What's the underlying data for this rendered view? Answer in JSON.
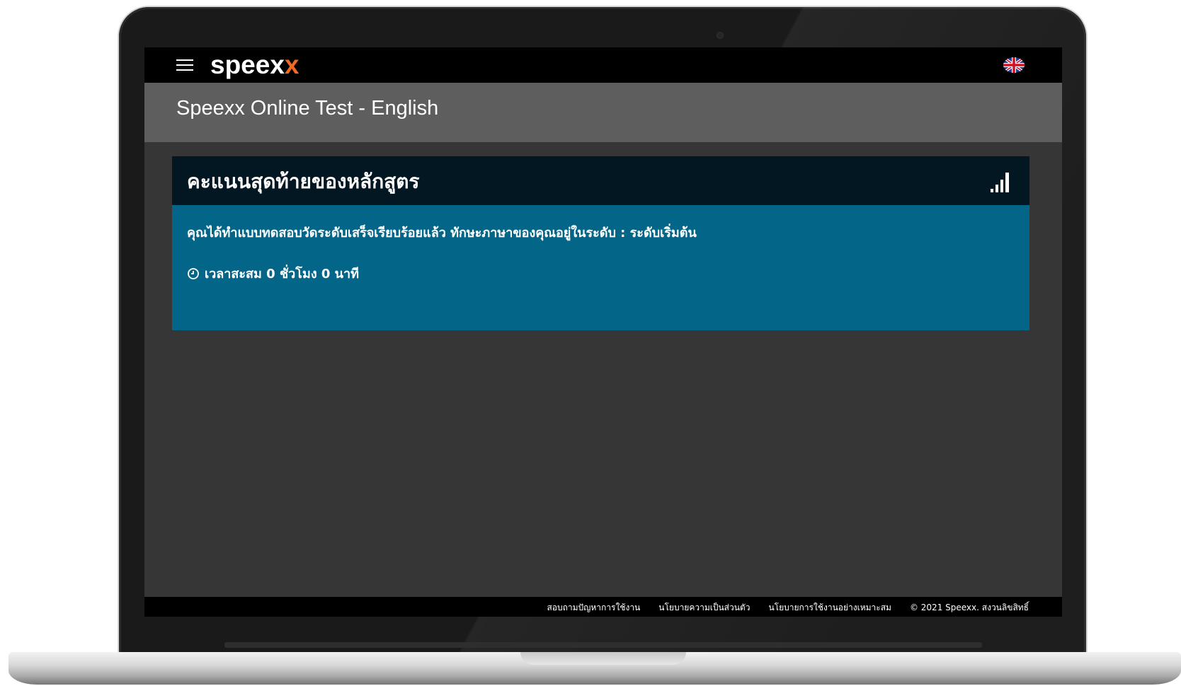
{
  "app": {
    "logo_prefix": "speex",
    "logo_suffix": "x",
    "brand_accent": "#f26a21"
  },
  "header": {
    "title": "Speexx Online Test - English",
    "menu_icon": "hamburger-menu-icon",
    "language_icon": "uk-flag-icon"
  },
  "result_card": {
    "title": "คะแนนสุดท้ายของหลักสูตร",
    "title_icon": "signal-bars-icon",
    "message": "คุณได้ทำแบบทดสอบวัดระดับเสร็จเรียบร้อยแล้ว ทักษะภาษาของคุณอยู่ในระดับ : ระดับเริ่มต้น",
    "time_icon": "clock-icon",
    "time_text": "เวลาสะสม 0 ชั่วโมง 0 นาที",
    "header_color": "#031722",
    "body_color": "#036688"
  },
  "footer": {
    "links": [
      "สอบถามปัญหาการใช้งาน",
      "นโยบายความเป็นส่วนตัว",
      "นโยบายการใช้งานอย่างเหมาะสม"
    ],
    "copyright": "© 2021 Speexx. สงวนลิขสิทธิ์"
  }
}
